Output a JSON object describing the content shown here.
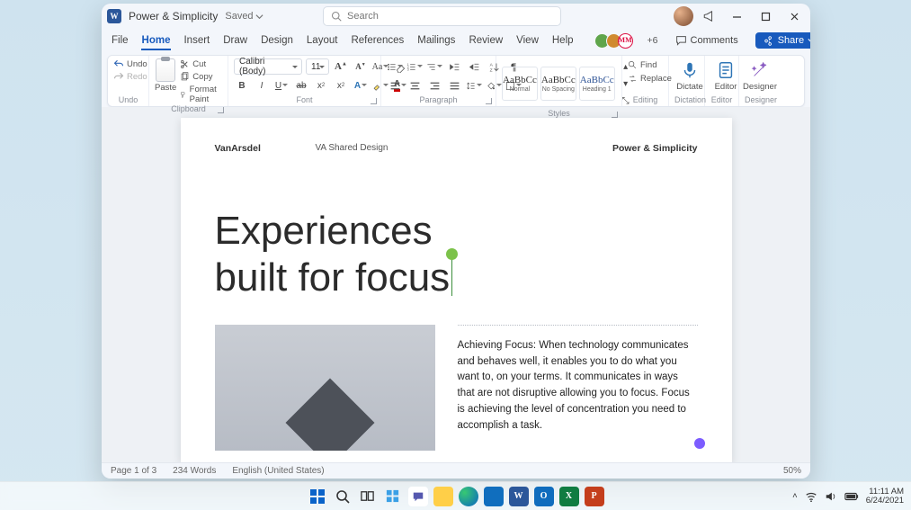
{
  "titlebar": {
    "app_letter": "W",
    "doc_title": "Power & Simplicity",
    "autosave_label": "Saved",
    "search_placeholder": "Search"
  },
  "tabs": {
    "items": [
      "File",
      "Home",
      "Insert",
      "Draw",
      "Design",
      "Layout",
      "References",
      "Mailings",
      "Review",
      "View",
      "Help"
    ],
    "active_index": 1,
    "presence_initials": "MM",
    "plus_count": "+6",
    "comments_label": "Comments",
    "share_label": "Share"
  },
  "ribbon": {
    "undo": {
      "undo": "Undo",
      "redo": "Redo",
      "group": "Undo"
    },
    "clipboard": {
      "paste": "Paste",
      "cut": "Cut",
      "copy": "Copy",
      "format_painter": "Format Paint",
      "group": "Clipboard"
    },
    "font": {
      "family": "Calibri (Body)",
      "size": "11",
      "group": "Font"
    },
    "paragraph": {
      "group": "Paragraph"
    },
    "styles": {
      "group": "Styles",
      "items": [
        {
          "preview": "AaBbCc",
          "name": "Normal"
        },
        {
          "preview": "AaBbCc",
          "name": "No Spacing"
        },
        {
          "preview": "AaBbCc",
          "name": "Heading 1"
        }
      ]
    },
    "editing": {
      "find": "Find",
      "replace": "Replace",
      "group": "Editing"
    },
    "dictation": {
      "dictate": "Dictate",
      "group": "Dictation"
    },
    "editor": {
      "editor": "Editor",
      "group": "Editor"
    },
    "designer": {
      "designer": "Designer",
      "group": "Designer"
    }
  },
  "doc": {
    "brand": "VanArsdel",
    "center": "VA Shared Design",
    "right": "Power & Simplicity",
    "title_line1": "Experiences",
    "title_line2": "built for focus",
    "body": "Achieving Focus: When technology communicates and behaves well, it enables you to do what you want to, on your terms. It communicates in ways that are not disruptive allowing you to focus. Focus is achieving the level of concentration you need to accomplish a task."
  },
  "status": {
    "page": "Page 1 of 3",
    "words": "234 Words",
    "lang": "English (United States)",
    "zoom": "50%"
  },
  "taskbar": {
    "time": "11:11 AM",
    "date": "6/24/2021"
  }
}
